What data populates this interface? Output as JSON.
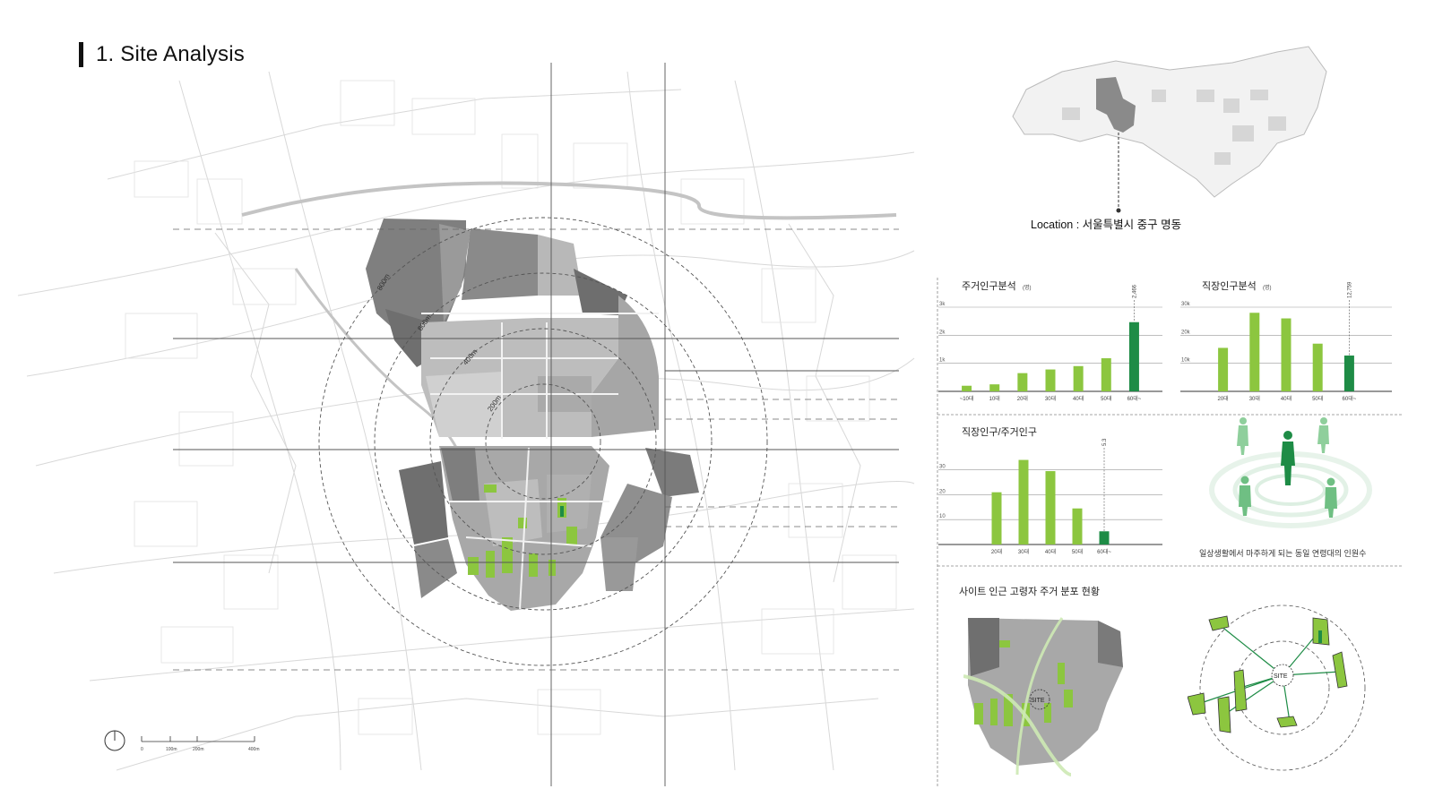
{
  "page": {
    "title": "1. Site Analysis",
    "location": "Location : 서울특별시 중구 명동",
    "site_label": "SITE",
    "people_caption": "일상생활에서 마주하게 되는 동일 연령대의 인원수",
    "elderly_title": "사이트 인근 고령자 주거 분포 현황",
    "scale_labels": [
      "0",
      "100m",
      "200m",
      "400m"
    ]
  },
  "map": {
    "radius_labels": [
      "800m",
      "600m",
      "400m",
      "200m"
    ]
  },
  "colors": {
    "bar_green": "#8cc63f",
    "bar_dark_green": "#1e8c46",
    "map_dark": "#7a7a7a",
    "map_mid": "#a3a3a3",
    "map_light": "#cfcfcf"
  },
  "chart_data": [
    {
      "type": "bar",
      "title": "주거인구분석",
      "unit": "(명)",
      "categories": [
        "~10대",
        "10대",
        "20대",
        "30대",
        "40대",
        "50대",
        "60대~"
      ],
      "values": [
        200,
        250,
        650,
        780,
        900,
        1180,
        2466
      ],
      "highlight_index": 6,
      "highlight_label": "2,466",
      "y_ticks": [
        {
          "v": 1000,
          "label": "1k"
        },
        {
          "v": 2000,
          "label": "2k"
        },
        {
          "v": 3000,
          "label": "3k"
        }
      ],
      "ylim": [
        0,
        3000
      ],
      "grid": true
    },
    {
      "type": "bar",
      "title": "직장인구분석",
      "unit": "(명)",
      "categories": [
        "20대",
        "30대",
        "40대",
        "50대",
        "60대~"
      ],
      "values": [
        15500,
        28000,
        26000,
        17000,
        12759
      ],
      "highlight_index": 4,
      "highlight_label": "12,759",
      "y_ticks": [
        {
          "v": 10000,
          "label": "10k"
        },
        {
          "v": 20000,
          "label": "20k"
        },
        {
          "v": 30000,
          "label": "30k"
        }
      ],
      "ylim": [
        0,
        30000
      ],
      "grid": true
    },
    {
      "type": "bar",
      "title": "직장인구/주거인구",
      "unit": "",
      "categories": [
        "20대",
        "30대",
        "40대",
        "50대",
        "60대~"
      ],
      "values": [
        21,
        34,
        29.5,
        14.5,
        5.3
      ],
      "highlight_index": 4,
      "highlight_label": "5.3",
      "y_ticks": [
        {
          "v": 10,
          "label": "10"
        },
        {
          "v": 20,
          "label": "20"
        },
        {
          "v": 30,
          "label": "30"
        }
      ],
      "ylim": [
        0,
        36
      ],
      "grid": true
    }
  ]
}
